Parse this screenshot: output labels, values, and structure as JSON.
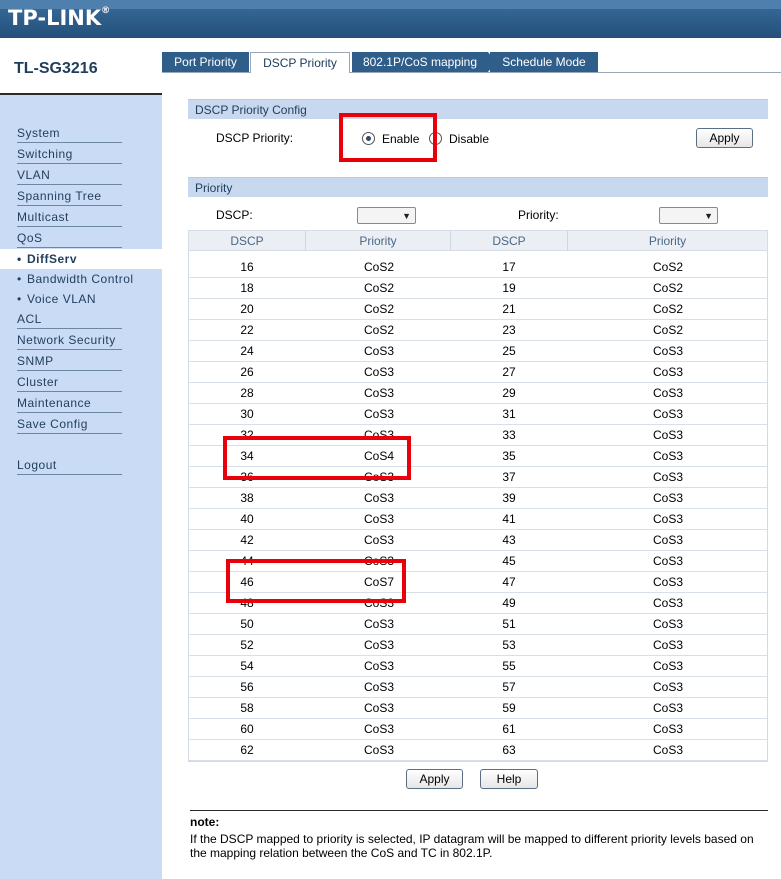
{
  "brand": {
    "logo": "TP-LINK",
    "reg": "®"
  },
  "model": "TL-SG3216",
  "tabs": [
    {
      "label": "Port Priority",
      "active": false
    },
    {
      "label": "DSCP Priority",
      "active": true
    },
    {
      "label": "802.1P/CoS mapping",
      "active": false
    },
    {
      "label": "Schedule Mode",
      "active": false
    }
  ],
  "sidebar": {
    "items": [
      "System",
      "Switching",
      "VLAN",
      "Spanning Tree",
      "Multicast",
      "QoS"
    ],
    "sub_items": [
      "DiffServ",
      "Bandwidth Control",
      "Voice VLAN"
    ],
    "items_after": [
      "ACL",
      "Network Security",
      "SNMP",
      "Cluster",
      "Maintenance",
      "Save Config"
    ],
    "logout": "Logout",
    "bullet": "•"
  },
  "config": {
    "header": "DSCP Priority Config",
    "label": "DSCP Priority:",
    "enable": "Enable",
    "disable": "Disable",
    "selected": "Enable",
    "apply": "Apply"
  },
  "priority": {
    "header": "Priority",
    "dscp_label": "DSCP:",
    "priority_label": "Priority:",
    "columns": [
      "DSCP",
      "Priority",
      "DSCP",
      "Priority"
    ],
    "rows": [
      [
        "16",
        "CoS2",
        "17",
        "CoS2"
      ],
      [
        "18",
        "CoS2",
        "19",
        "CoS2"
      ],
      [
        "20",
        "CoS2",
        "21",
        "CoS2"
      ],
      [
        "22",
        "CoS2",
        "23",
        "CoS2"
      ],
      [
        "24",
        "CoS3",
        "25",
        "CoS3"
      ],
      [
        "26",
        "CoS3",
        "27",
        "CoS3"
      ],
      [
        "28",
        "CoS3",
        "29",
        "CoS3"
      ],
      [
        "30",
        "CoS3",
        "31",
        "CoS3"
      ],
      [
        "32",
        "CoS3",
        "33",
        "CoS3"
      ],
      [
        "34",
        "CoS4",
        "35",
        "CoS3"
      ],
      [
        "36",
        "CoS3",
        "37",
        "CoS3"
      ],
      [
        "38",
        "CoS3",
        "39",
        "CoS3"
      ],
      [
        "40",
        "CoS3",
        "41",
        "CoS3"
      ],
      [
        "42",
        "CoS3",
        "43",
        "CoS3"
      ],
      [
        "44",
        "CoS3",
        "45",
        "CoS3"
      ],
      [
        "46",
        "CoS7",
        "47",
        "CoS3"
      ],
      [
        "48",
        "CoS3",
        "49",
        "CoS3"
      ],
      [
        "50",
        "CoS3",
        "51",
        "CoS3"
      ],
      [
        "52",
        "CoS3",
        "53",
        "CoS3"
      ],
      [
        "54",
        "CoS3",
        "55",
        "CoS3"
      ],
      [
        "56",
        "CoS3",
        "57",
        "CoS3"
      ],
      [
        "58",
        "CoS3",
        "59",
        "CoS3"
      ],
      [
        "60",
        "CoS3",
        "61",
        "CoS3"
      ],
      [
        "62",
        "CoS3",
        "63",
        "CoS3"
      ]
    ],
    "apply": "Apply",
    "help": "Help"
  },
  "note": {
    "title": "note:",
    "text": "If the DSCP mapped to priority is selected, IP datagram will be mapped to different priority levels based on the mapping relation between the CoS and TC in 802.1P."
  },
  "colors": {
    "header": "#2d5f8e",
    "sidebar": "#c9dbf5",
    "highlight": "#e8000a"
  }
}
